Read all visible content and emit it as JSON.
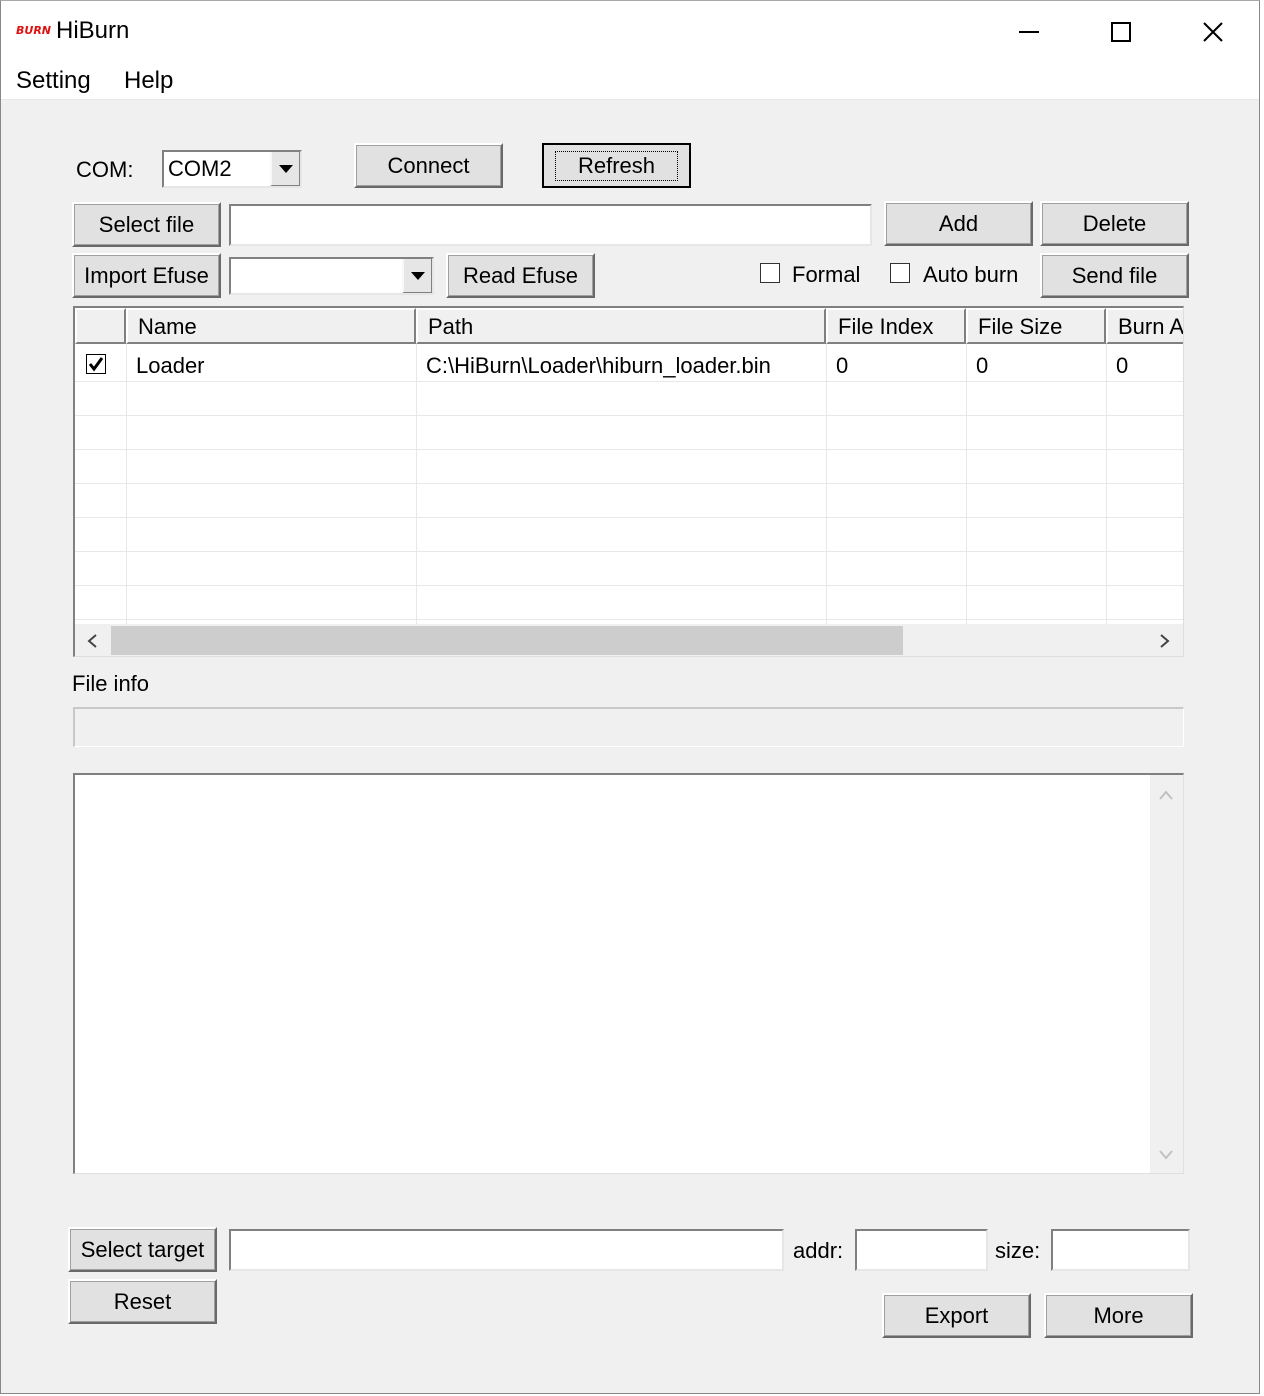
{
  "window": {
    "logo_text": "BURN",
    "title": "HiBurn",
    "colors": {
      "logo": "#dd1111",
      "face": "#f0f0f0",
      "button": "#e1e1e1"
    }
  },
  "menu": {
    "items": [
      "Setting",
      "Help"
    ]
  },
  "connection": {
    "com_label": "COM:",
    "com_value": "COM2",
    "connect_label": "Connect",
    "refresh_label": "Refresh"
  },
  "file_bar": {
    "select_file_label": "Select file",
    "file_path_value": "",
    "add_label": "Add",
    "delete_label": "Delete"
  },
  "efuse_bar": {
    "import_label": "Import Efuse",
    "efuse_value": "",
    "read_label": "Read Efuse",
    "formal_label": "Formal",
    "formal_checked": false,
    "autoburn_label": "Auto burn",
    "autoburn_checked": false,
    "send_label": "Send file"
  },
  "table": {
    "columns": [
      "",
      "Name",
      "Path",
      "File Index",
      "File Size",
      "Burn A"
    ],
    "rows": [
      {
        "checked": true,
        "name": "Loader",
        "path": "C:\\HiBurn\\Loader\\hiburn_loader.bin",
        "file_index": "0",
        "file_size": "0",
        "burn_addr": "0"
      }
    ]
  },
  "file_info": {
    "label": "File info"
  },
  "target": {
    "select_target_label": "Select target",
    "target_value": "",
    "addr_label": "addr:",
    "addr_value": "",
    "size_label": "size:",
    "size_value": ""
  },
  "actions": {
    "reset_label": "Reset",
    "export_label": "Export",
    "more_label": "More"
  }
}
